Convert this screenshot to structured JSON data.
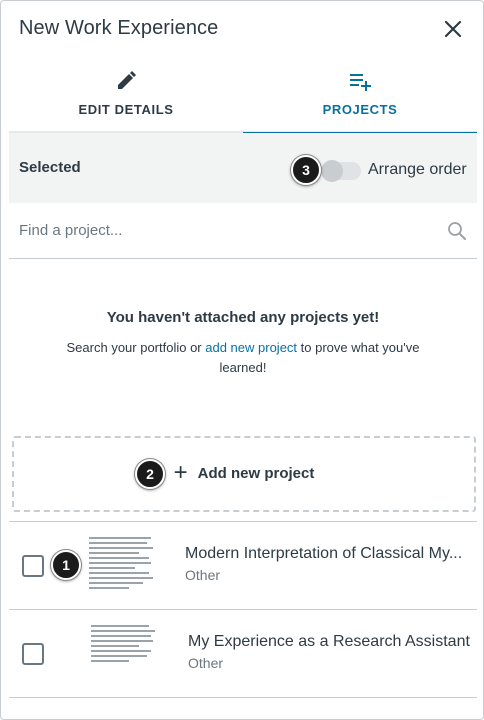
{
  "header": {
    "title": "New Work Experience",
    "close_icon": "close-icon"
  },
  "tabs": [
    {
      "label": "EDIT DETAILS",
      "icon": "pencil-icon",
      "active": false
    },
    {
      "label": "PROJECTS",
      "icon": "playlist-add-icon",
      "active": true
    }
  ],
  "selected_bar": {
    "label": "Selected",
    "arrange_label": "Arrange order",
    "arrange_enabled": false
  },
  "search": {
    "placeholder": "Find a project..."
  },
  "empty_state": {
    "title": "You haven't attached any projects yet!",
    "body_before": "Search your portfolio or ",
    "link_text": "add new project",
    "body_after": " to prove what you've learned!"
  },
  "add_project": {
    "label": "Add new project"
  },
  "projects": [
    {
      "title": "Modern Interpretation of Classical My...",
      "type": "Other"
    },
    {
      "title": "My Experience as a Research Assistant",
      "type": "Other"
    }
  ],
  "callouts": [
    "1",
    "2",
    "3"
  ],
  "colors": {
    "accent": "#0770a3",
    "text": "#2d3b45",
    "muted": "#6b7780",
    "border": "#c7cdd1",
    "bar_bg": "#f2f4f4",
    "callout_bg": "#1b1b1b"
  }
}
